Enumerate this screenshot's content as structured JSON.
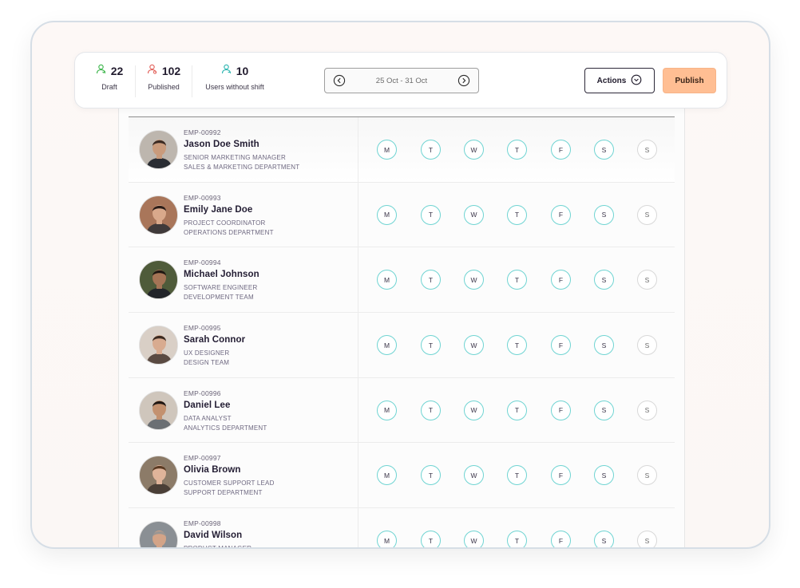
{
  "stats": [
    {
      "value": "22",
      "label": "Draft",
      "color": "#3bb54a"
    },
    {
      "value": "102",
      "label": "Published",
      "color": "#e2615a"
    },
    {
      "value": "10",
      "label": "Users without shift",
      "color": "#2bb5b0"
    }
  ],
  "date_range": "25 Oct - 31 Oct",
  "actions_label": "Actions",
  "publish_label": "Publish",
  "days": [
    "M",
    "T",
    "W",
    "T",
    "F",
    "S",
    "S"
  ],
  "employees": [
    {
      "id": "EMP-00992",
      "name": "Jason Doe Smith",
      "role": "SENIOR MARKETING MANAGER",
      "dept": "SALES & MARKETING DEPARTMENT"
    },
    {
      "id": "EMP-00993",
      "name": "Emily Jane Doe",
      "role": "PROJECT COORDINATOR",
      "dept": "OPERATIONS DEPARTMENT"
    },
    {
      "id": "EMP-00994",
      "name": "Michael Johnson",
      "role": "SOFTWARE ENGINEER",
      "dept": "DEVELOPMENT TEAM"
    },
    {
      "id": "EMP-00995",
      "name": "Sarah Connor",
      "role": "UX DESIGNER",
      "dept": "DESIGN TEAM"
    },
    {
      "id": "EMP-00996",
      "name": "Daniel Lee",
      "role": "DATA ANALYST",
      "dept": "ANALYTICS DEPARTMENT"
    },
    {
      "id": "EMP-00997",
      "name": "Olivia Brown",
      "role": "CUSTOMER SUPPORT LEAD",
      "dept": "SUPPORT DEPARTMENT"
    },
    {
      "id": "EMP-00998",
      "name": "David Wilson",
      "role": "PRODUCT MANAGER",
      "dept": ""
    }
  ],
  "colors": {
    "accent_teal": "#6fd4d2",
    "publish": "#ffbe93",
    "off_day": "#d8d8d8"
  }
}
